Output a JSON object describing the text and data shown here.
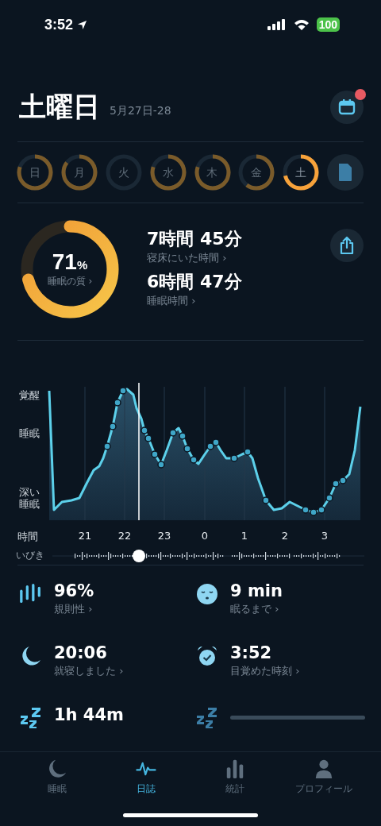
{
  "status_bar": {
    "time": "3:52",
    "battery": "100"
  },
  "header": {
    "title": "土曜日",
    "date_range": "5月27日-28",
    "calendar_badge": true
  },
  "days": [
    {
      "label": "日",
      "selected": false
    },
    {
      "label": "月",
      "selected": false
    },
    {
      "label": "火",
      "selected": false
    },
    {
      "label": "水",
      "selected": false
    },
    {
      "label": "木",
      "selected": false
    },
    {
      "label": "金",
      "selected": false
    },
    {
      "label": "土",
      "selected": true
    }
  ],
  "summary": {
    "quality": {
      "value": "71",
      "unit": "%",
      "label": "睡眠の質 ›"
    },
    "metrics": [
      {
        "value": "7時間 45分",
        "label": "寝床にいた時間 ›"
      },
      {
        "value": "6時間 47分",
        "label": "睡眠時間 ›"
      }
    ]
  },
  "sleep_graph": {
    "y_labels": [
      "覚醒",
      "睡眠",
      "深い睡眠"
    ],
    "x_label": "時間",
    "x_ticks": [
      "21",
      "22",
      "23",
      "0",
      "1",
      "2",
      "3"
    ],
    "snore_label": "いびき"
  },
  "stats": [
    {
      "kind": "regularity",
      "value": "96%",
      "label": "規則性 ›"
    },
    {
      "kind": "fall-asleep",
      "value": "9 min",
      "label": "眠るまで ›"
    },
    {
      "kind": "bedtime",
      "value": "20:06",
      "label": "就寝しました ›"
    },
    {
      "kind": "wake",
      "value": "3:52",
      "label": "目覚めた時刻 ›"
    },
    {
      "kind": "snore",
      "value": "1h 44m"
    },
    {
      "kind": "loading"
    }
  ],
  "tabs": [
    {
      "label": "睡眠",
      "selected": false
    },
    {
      "label": "日誌",
      "selected": true
    },
    {
      "label": "統計",
      "selected": false
    },
    {
      "label": "プロフィール",
      "selected": false
    }
  ]
}
